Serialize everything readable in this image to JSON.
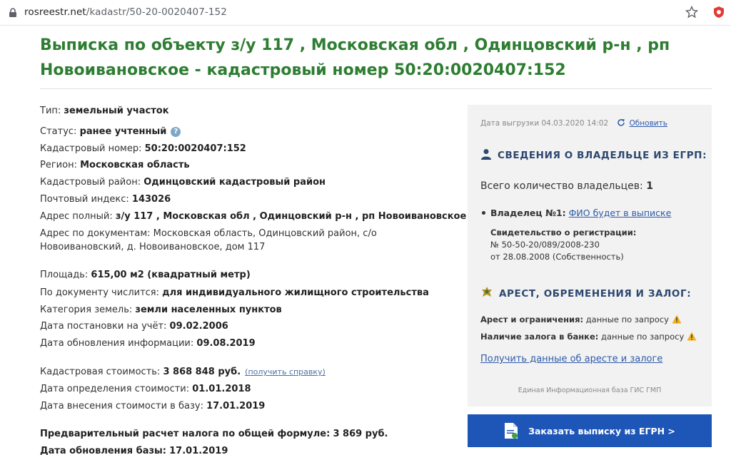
{
  "browser": {
    "url_host": "rosreestr.net",
    "url_path": "/kadastr/50-20-0020407-152"
  },
  "title": {
    "line1": "Выписка по объекту з/у 117 , Московская обл , Одинцовский р-н , рп",
    "line2": "Новоивановское - кадастровый номер 50:20:0020407:152"
  },
  "info": {
    "type": {
      "label": "Тип:",
      "value": "земельный участок"
    },
    "status": {
      "label": "Статус:",
      "value": "ранее учтенный"
    },
    "cadastral_number": {
      "label": "Кадастровый номер:",
      "value": "50:20:0020407:152"
    },
    "region": {
      "label": "Регион:",
      "value": "Московская область"
    },
    "cadastral_district": {
      "label": "Кадастровый район:",
      "value": "Одинцовский кадастровый район"
    },
    "postal_code": {
      "label": "Почтовый индекс:",
      "value": "143026"
    },
    "address_full": {
      "label": "Адрес полный:",
      "value": "з/у 117 , Московская обл , Одинцовский р-н , рп Новоивановское"
    },
    "address_docs": {
      "label": "Адрес по документам:",
      "value_line1": "Московская область, Одинцовский район, с/о",
      "value_line2": "Новоивановский, д. Новоивановское, дом 117"
    },
    "area": {
      "label": "Площадь:",
      "value": "615,00 м2 (квадратный метр)"
    },
    "by_document": {
      "label": "По документу числится:",
      "value": "для индивидуального жилищного строительства"
    },
    "land_category": {
      "label": "Категория земель:",
      "value": "земли населенных пунктов"
    },
    "registration_date": {
      "label": "Дата постановки на учёт:",
      "value": "09.02.2006"
    },
    "update_date": {
      "label": "Дата обновления информации:",
      "value": "09.08.2019"
    },
    "cadastral_value": {
      "label": "Кадастровая стоимость:",
      "value": "3 868 848 руб.",
      "link": "(получить справку)"
    },
    "value_date": {
      "label": "Дата определения стоимости:",
      "value": "01.01.2018"
    },
    "value_entry_date": {
      "label": "Дата внесения стоимости в базу:",
      "value": "17.01.2019"
    },
    "tax_estimate": {
      "label": "Предварительный расчет налога по общей формуле:",
      "value": "3 869 руб."
    },
    "base_update": {
      "label": "Дата обновления базы:",
      "value": "17.01.2019"
    }
  },
  "panel": {
    "export_date": "Дата выгрузки 04.03.2020 14:02",
    "refresh_label": "Обновить",
    "owners_title": "СВЕДЕНИЯ О ВЛАДЕЛЬЦЕ ИЗ ЕГРП:",
    "owners_count_label": "Всего количество владельцев:",
    "owners_count": "1",
    "owner_label": "Владелец №1:",
    "owner_link": "ФИО будет в выписке",
    "cert_label": "Свидетельство о регистрации:",
    "cert_number": "№ 50-50-20/089/2008-230",
    "cert_date": "от 28.08.2008 (Собственность)",
    "arrest_title": "АРЕСТ, ОБРЕМЕНЕНИЯ И ЗАЛОГ:",
    "arrest_label": "Арест и ограничения:",
    "arrest_value": "данные по запросу",
    "pledge_label": "Наличие залога в банке:",
    "pledge_value": "данные по запросу",
    "arrest_link": "Получить данные об аресте и залоге",
    "footer": "Единая Информационная база ГИС ГМП"
  },
  "order_button": {
    "label": "Заказать выписку из ЕГРН >"
  },
  "colors": {
    "title_green": "#2e7d32",
    "panel_bg": "#f2f2f2",
    "button_blue": "#1e56b8",
    "link_blue": "#2e5aa8",
    "section_navy": "#2c4770"
  }
}
